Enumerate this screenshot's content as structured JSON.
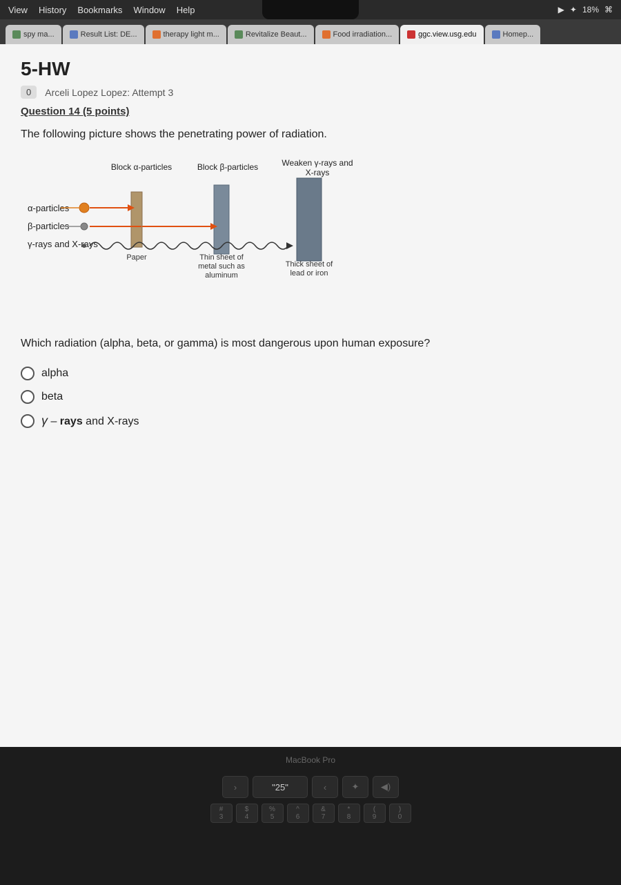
{
  "menubar": {
    "view": "View",
    "history": "History",
    "bookmarks": "Bookmarks",
    "window": "Window",
    "help": "Help",
    "battery": "18%",
    "wifi": "WiFi"
  },
  "tabs": [
    {
      "id": "tab1",
      "label": "spy ma...",
      "icon_color": "#5a8a5a",
      "active": false
    },
    {
      "id": "tab2",
      "label": "Result List: DE...",
      "icon_color": "#5a7abf",
      "active": false
    },
    {
      "id": "tab3",
      "label": "therapy light m...",
      "icon_color": "#e07030",
      "active": false
    },
    {
      "id": "tab4",
      "label": "Revitalize Beaut...",
      "icon_color": "#5a8a5a",
      "active": false
    },
    {
      "id": "tab5",
      "label": "Food irradiation...",
      "icon_color": "#e07030",
      "active": false
    },
    {
      "id": "tab6",
      "label": "ggc.view.usg.edu",
      "icon_color": "#cc3333",
      "active": true
    },
    {
      "id": "tab7",
      "label": "Homep...",
      "icon_color": "#5a7abf",
      "active": false
    }
  ],
  "page": {
    "title": "5-HW",
    "attempt_label": "0",
    "student_name": "Arceli Lopez Lopez: Attempt 3",
    "question_header": "Question 14 (5 points)",
    "diagram_intro": "The following picture shows the penetrating power of radiation.",
    "diagram": {
      "block_alpha_label": "Block α-particles",
      "block_beta_label": "Block β-particles",
      "weaken_label": "Weaken γ-rays and X-rays",
      "particle_alpha": "α-particles",
      "particle_beta": "β-particles",
      "particle_gamma": "γ-rays and X-rays",
      "barrier_paper": "Paper",
      "barrier_thin": "Thin sheet of metal such as aluminum",
      "barrier_thick": "Thick sheet of lead or iron"
    },
    "question_prompt": "Which radiation (alpha, beta, or gamma) is most dangerous upon human exposure?",
    "answer_choices": [
      {
        "id": "alpha",
        "label": "alpha",
        "selected": false
      },
      {
        "id": "beta",
        "label": "beta",
        "selected": false
      },
      {
        "id": "gamma",
        "label": "γ – rays and X-rays",
        "selected": false
      }
    ]
  },
  "bottom_bar": {
    "label": "\"25\"",
    "macbook": "MacBook Pro"
  },
  "keyboard": {
    "keys": [
      "3",
      "4",
      "5",
      "6",
      "7",
      "8",
      "9",
      "0"
    ]
  }
}
